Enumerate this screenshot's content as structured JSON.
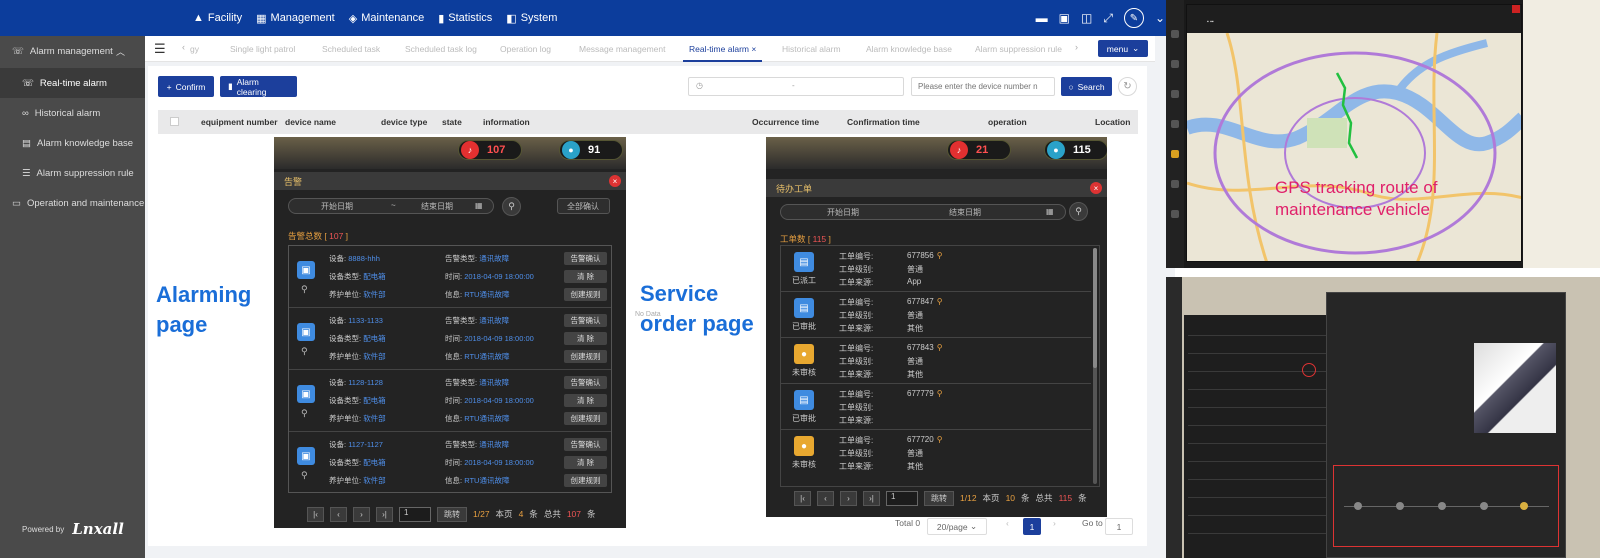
{
  "topnav": [
    {
      "icon": "facility-icon",
      "glyph": "▲",
      "label": "Facility"
    },
    {
      "icon": "management-icon",
      "glyph": "▦",
      "label": "Management"
    },
    {
      "icon": "maintenance-icon",
      "glyph": "◈",
      "label": "Maintenance"
    },
    {
      "icon": "statistics-icon",
      "glyph": "▮",
      "label": "Statistics"
    },
    {
      "icon": "system-icon",
      "glyph": "◧",
      "label": "System"
    }
  ],
  "sidebar": {
    "items": [
      {
        "label": "Alarm management",
        "glyph": "☏"
      },
      {
        "label": "Real-time alarm",
        "glyph": "☏"
      },
      {
        "label": "Historical alarm",
        "glyph": "∞"
      },
      {
        "label": "Alarm knowledge base",
        "glyph": "▤"
      },
      {
        "label": "Alarm suppression rule",
        "glyph": "☰"
      },
      {
        "label": "Operation and maintenance ma",
        "glyph": "▭"
      }
    ],
    "powered_by": "Powered by",
    "brand": "Lnxall"
  },
  "tabs": [
    "gy",
    "Single light patrol",
    "Scheduled task",
    "Scheduled task log",
    "Operation log",
    "Message management",
    "Real-time alarm",
    "Historical alarm",
    "Alarm knowledge base",
    "Alarm suppression rule"
  ],
  "menu_label": "menu",
  "toolbar": {
    "confirm": "Confirm",
    "clearing": "Alarm clearing",
    "date_separator": "-",
    "device_placeholder": "Please enter the device number n",
    "search": "Search"
  },
  "table": {
    "columns": [
      "equipment number",
      "device name",
      "device type",
      "state",
      "information",
      "Occurrence time",
      "Confirmation time",
      "operation",
      "Location"
    ],
    "empty": "No Data"
  },
  "pagination": {
    "total": "Total 0",
    "page_size": "20/page",
    "current": "1",
    "goto_label": "Go to",
    "goto_value": "1"
  },
  "callouts": {
    "alarming_line1": "Alarming",
    "alarming_line2": "page",
    "service_line1": "Service",
    "service_line2": "order page"
  },
  "alarm_phone": {
    "alarm_count": "107",
    "user_count": "91",
    "title": "告警",
    "start_date": "开始日期",
    "date_sep": "~",
    "end_date": "结束日期",
    "confirm_all": "全部确认",
    "total_label": "告警总数 [",
    "total_value": "107",
    "total_end": "]",
    "labels": {
      "device": "设备:",
      "device_type": "设备类型:",
      "unit": "养护单位:",
      "alarm_type": "告警类型:",
      "time": "时间:",
      "info": "信息:"
    },
    "actions": {
      "confirm": "告警确认",
      "clear": "清 除",
      "rule": "创建规则"
    },
    "items": [
      {
        "device": "8888-hhh",
        "device_type": "配电箱",
        "unit": "软件部",
        "alarm_type": "通讯故障",
        "time": "2018-04-09 18:00:00",
        "info": "RTU通讯故障"
      },
      {
        "device": "1133-1133",
        "device_type": "配电箱",
        "unit": "软件部",
        "alarm_type": "通讯故障",
        "time": "2018-04-09 18:00:00",
        "info": "RTU通讯故障"
      },
      {
        "device": "1128-1128",
        "device_type": "配电箱",
        "unit": "软件部",
        "alarm_type": "通讯故障",
        "time": "2018-04-09 18:00:00",
        "info": "RTU通讯故障"
      },
      {
        "device": "1127-1127",
        "device_type": "配电箱",
        "unit": "软件部",
        "alarm_type": "通讯故障",
        "time": "2018-04-09 18:00:00",
        "info": "RTU通讯故障"
      }
    ],
    "pager": {
      "input": "1",
      "go": "跳转",
      "page": "1/27",
      "this_page": "本页",
      "this_count": "4",
      "unit": "条",
      "total_label": "总共",
      "total_count": "107"
    }
  },
  "order_phone": {
    "alarm_count": "21",
    "user_count": "115",
    "title": "待办工单",
    "start_date": "开始日期",
    "end_date": "结束日期",
    "count_label": "工单数 [",
    "count_value": "115",
    "count_end": "]",
    "labels": {
      "number": "工单编号:",
      "level": "工单级别:",
      "source": "工单来源:"
    },
    "items": [
      {
        "status": "已派工",
        "number": "677856",
        "level": "普通",
        "source": "App",
        "color": "#3f8be0"
      },
      {
        "status": "已审批",
        "number": "677847",
        "level": "普通",
        "source": "其他",
        "color": "#3f8be0"
      },
      {
        "status": "未审核",
        "number": "677843",
        "level": "普通",
        "source": "其他",
        "color": "#e8a830"
      },
      {
        "status": "已审批",
        "number": "677779",
        "level": "",
        "source": "",
        "color": "#3f8be0"
      },
      {
        "status": "未审核",
        "number": "677720",
        "level": "普通",
        "source": "其他",
        "color": "#e8a830"
      }
    ],
    "pager": {
      "input": "1",
      "go": "跳转",
      "page": "1/12",
      "this_page": "本页",
      "this_count": "10",
      "unit": "条",
      "total_label": "总共",
      "total_count": "115"
    }
  },
  "map_caption": "GPS tracking route of maintenance vehicle",
  "colors": {
    "primary": "#1c3f9c",
    "topbar": "#0c3d9c",
    "callout": "#1a6ed8",
    "caption": "#e0206a"
  }
}
